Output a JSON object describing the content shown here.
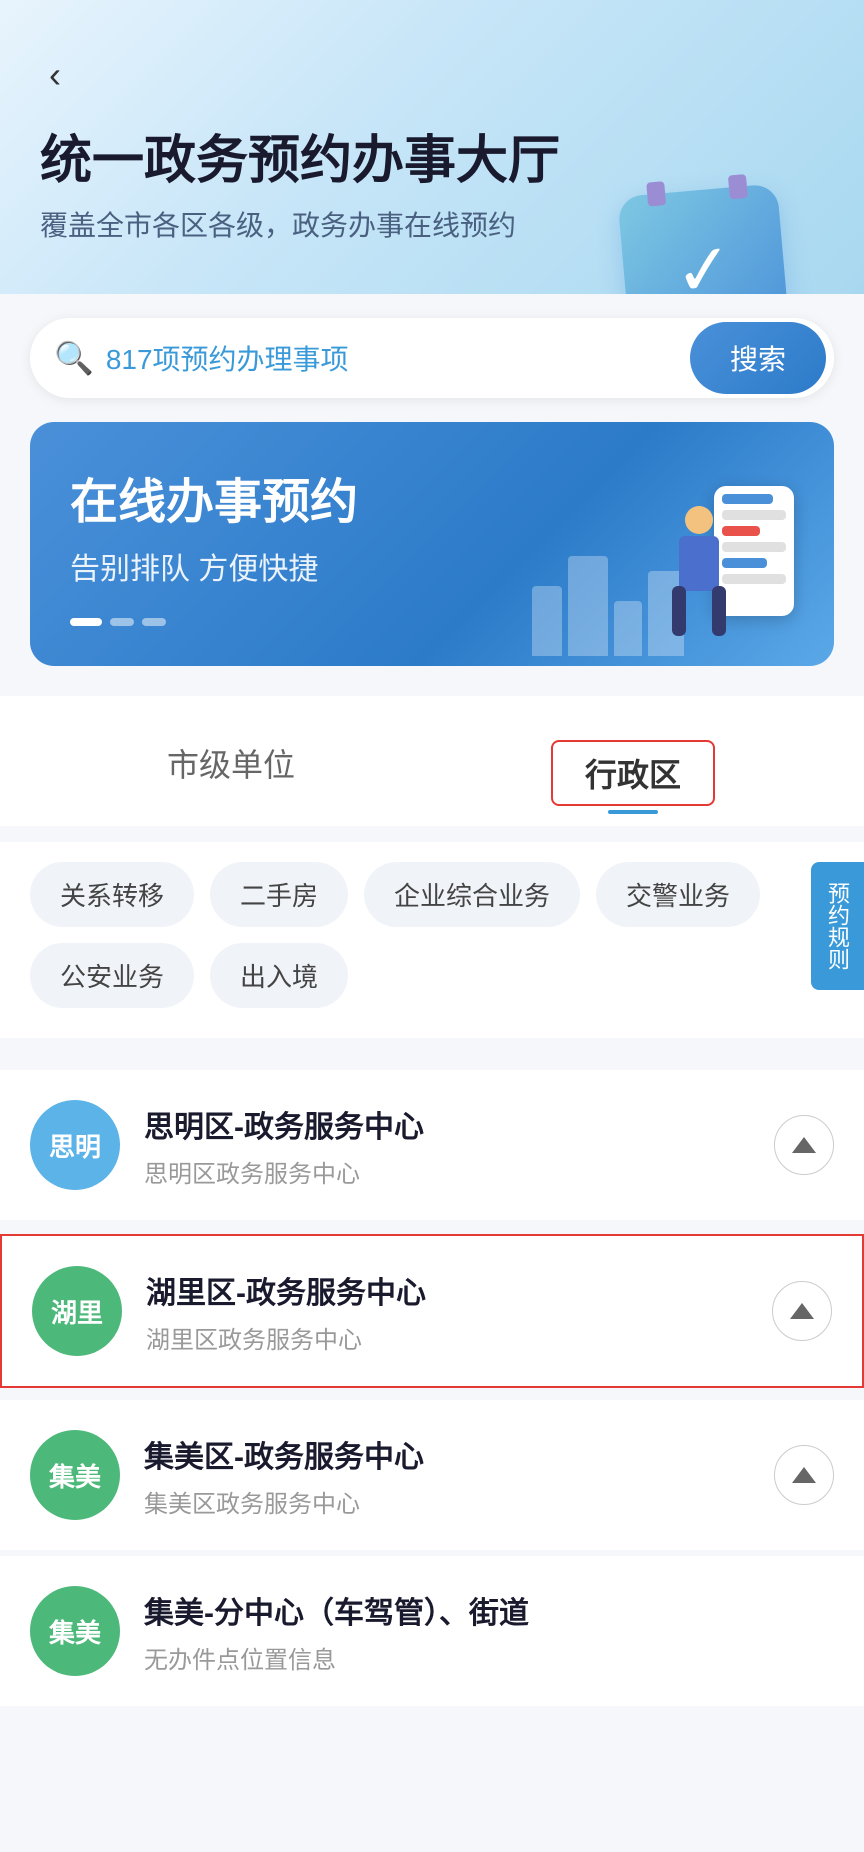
{
  "nav": {
    "back_label": "‹"
  },
  "hero": {
    "title": "统一政务预约办事大厅",
    "subtitle": "覆盖全市各区各级，政务办事在线预约"
  },
  "search": {
    "placeholder": "817项预约办理事项",
    "button_label": "搜索"
  },
  "banner": {
    "title": "在线办事预约",
    "subtitle": "告别排队 方便快捷",
    "dots": [
      "active",
      "inactive",
      "inactive"
    ]
  },
  "tabs": {
    "items": [
      {
        "id": "municipal",
        "label": "市级单位",
        "active": false
      },
      {
        "id": "district",
        "label": "行政区",
        "active": true
      }
    ]
  },
  "categories": [
    {
      "id": "relation-transfer",
      "label": "关系转移"
    },
    {
      "id": "second-hand-house",
      "label": "二手房"
    },
    {
      "id": "enterprise-business",
      "label": "企业综合业务"
    },
    {
      "id": "traffic-police",
      "label": "交警业务"
    },
    {
      "id": "public-security",
      "label": "公安业务"
    },
    {
      "id": "entry-exit",
      "label": "出入境"
    }
  ],
  "side_button": {
    "label": "预约规则"
  },
  "list_items": [
    {
      "id": "siming",
      "avatar_text": "思明",
      "avatar_color": "blue",
      "title": "思明区-政务服务中心",
      "subtitle": "思明区政务服务中心",
      "highlighted": false
    },
    {
      "id": "huli",
      "avatar_text": "湖里",
      "avatar_color": "green",
      "title": "湖里区-政务服务中心",
      "subtitle": "湖里区政务服务中心",
      "highlighted": true
    },
    {
      "id": "jimei",
      "avatar_text": "集美",
      "avatar_color": "green",
      "title": "集美区-政务服务中心",
      "subtitle": "集美区政务服务中心",
      "highlighted": false
    },
    {
      "id": "jimei-branch",
      "avatar_text": "集美",
      "avatar_color": "green",
      "title": "集美-分中心（车驾管）、街道",
      "subtitle": "无办件点位置信息",
      "highlighted": false
    }
  ]
}
